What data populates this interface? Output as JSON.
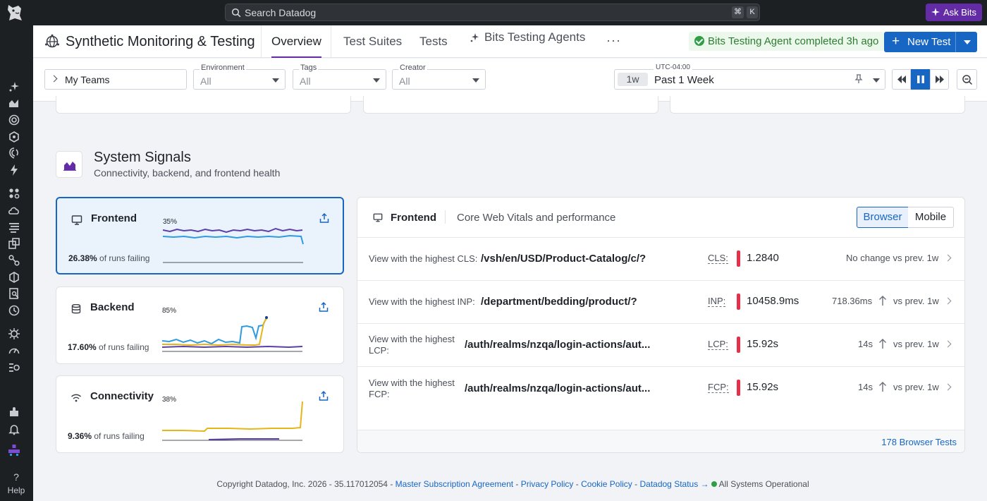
{
  "global": {
    "search_placeholder": "Search Datadog",
    "search_shortcut": [
      "⌘",
      "K"
    ],
    "ask_bits": "Ask Bits",
    "help": "Help"
  },
  "header": {
    "app_title": "Synthetic Monitoring & Testing",
    "tabs": [
      {
        "label": "Overview",
        "active": true
      },
      {
        "label": "Test Suites"
      },
      {
        "label": "Tests"
      },
      {
        "label": "Bits Testing Agents"
      }
    ],
    "more": "···",
    "status": "Bits Testing Agent completed 3h ago",
    "new_test": "New Test"
  },
  "filters": {
    "teams": "My Teams",
    "environment": {
      "label": "Environment",
      "value": "All"
    },
    "tags": {
      "label": "Tags",
      "value": "All"
    },
    "creator": {
      "label": "Creator",
      "value": "All"
    },
    "time": {
      "timezone": "UTC-04:00",
      "short": "1w",
      "label": "Past 1 Week"
    }
  },
  "section": {
    "title": "System Signals",
    "subtitle": "Connectivity, backend, and frontend health"
  },
  "signals": [
    {
      "name": "Frontend",
      "peak_label": "35%",
      "fail_pct": "26.38%",
      "fail_text": " of runs failing"
    },
    {
      "name": "Backend",
      "peak_label": "85%",
      "fail_pct": "17.60%",
      "fail_text": " of runs failing"
    },
    {
      "name": "Connectivity",
      "peak_label": "38%",
      "fail_pct": "9.36%",
      "fail_text": " of runs failing"
    }
  ],
  "detail": {
    "title": "Frontend",
    "subtitle": "Core Web Vitals and performance",
    "toggle": [
      "Browser",
      "Mobile"
    ],
    "rows": [
      {
        "label": "View with the highest CLS:",
        "path": "/vsh/en/USD/Product-Catalog/c/?",
        "metric": "CLS:",
        "value": "1.2840",
        "prev": "",
        "comparison": "No change vs prev. 1w"
      },
      {
        "label": "View with the highest INP:",
        "path": "/department/bedding/product/?",
        "metric": "INP:",
        "value": "10458.9ms",
        "prev": "718.36ms",
        "comparison": "vs prev. 1w"
      },
      {
        "label_l1": "View with the highest",
        "label_l2": "LCP:",
        "path": "/auth/realms/nzqa/login-actions/aut...",
        "metric": "LCP:",
        "value": "15.92s",
        "prev": "14s",
        "comparison": "vs prev. 1w"
      },
      {
        "label_l1": "View with the highest",
        "label_l2": "FCP:",
        "path": "/auth/realms/nzqa/login-actions/aut...",
        "metric": "FCP:",
        "value": "15.92s",
        "prev": "14s",
        "comparison": "vs prev. 1w"
      }
    ],
    "footer_link": "178 Browser Tests"
  },
  "footer": {
    "copyright": "Copyright Datadog, Inc. 2026 - 35.117012054 - ",
    "links": [
      "Master Subscription Agreement",
      "Privacy Policy",
      "Cookie Policy",
      "Datadog Status →"
    ],
    "sep": " - ",
    "status": "All Systems Operational"
  },
  "colors": {
    "brand": "#632ca6",
    "primary": "#1766c4",
    "success": "#2f9e44",
    "alert": "#e5304b",
    "series_purple": "#5b3ea8",
    "series_blue": "#2e9be0",
    "series_yellow": "#e6b619"
  }
}
